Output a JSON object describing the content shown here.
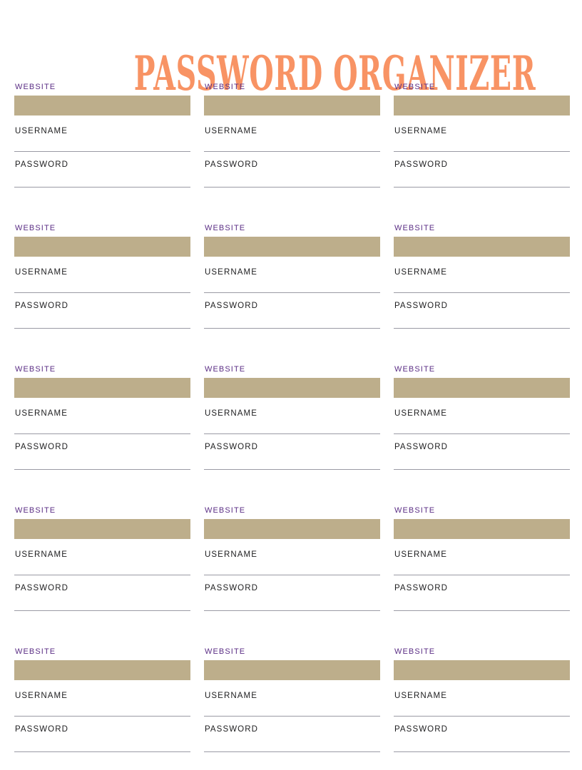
{
  "page": {
    "title": "PASSWORD ORGANIZER",
    "background_color": "#FFFFFF"
  },
  "theme": {
    "title_color": "#F89364",
    "website_label_color": "#5B2E85",
    "website_bar_color": "#BDAE8B",
    "field_label_color": "#1D1D1F",
    "rule_color": "#9A9AA4"
  },
  "labels": {
    "website": "WEBSITE",
    "username": "USERNAME",
    "password": "PASSWORD"
  },
  "grid": {
    "columns": 3,
    "rows": 5,
    "entries": [
      {
        "website": "",
        "username": "",
        "password": ""
      },
      {
        "website": "",
        "username": "",
        "password": ""
      },
      {
        "website": "",
        "username": "",
        "password": ""
      },
      {
        "website": "",
        "username": "",
        "password": ""
      },
      {
        "website": "",
        "username": "",
        "password": ""
      },
      {
        "website": "",
        "username": "",
        "password": ""
      },
      {
        "website": "",
        "username": "",
        "password": ""
      },
      {
        "website": "",
        "username": "",
        "password": ""
      },
      {
        "website": "",
        "username": "",
        "password": ""
      },
      {
        "website": "",
        "username": "",
        "password": ""
      },
      {
        "website": "",
        "username": "",
        "password": ""
      },
      {
        "website": "",
        "username": "",
        "password": ""
      },
      {
        "website": "",
        "username": "",
        "password": ""
      },
      {
        "website": "",
        "username": "",
        "password": ""
      },
      {
        "website": "",
        "username": "",
        "password": ""
      }
    ]
  }
}
